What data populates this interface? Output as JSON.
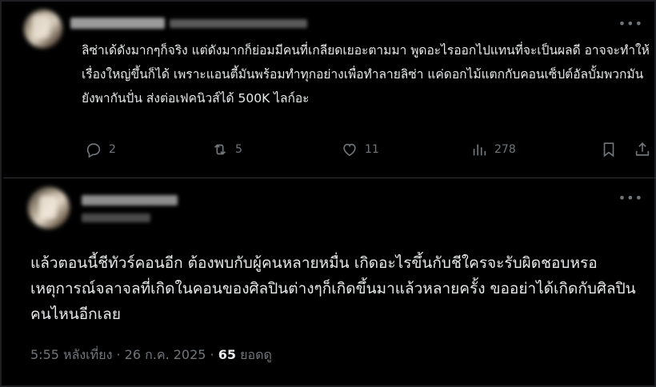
{
  "reply": {
    "text": "ลิซ่าเด้ดังมากๆก็จริง แต่ดังมากก็ย่อมมีคนที่เกลียดเยอะตามมา พูดอะไรออกไปแทนที่จะเป็นผลดี อาจจะทำให้เรื่องใหญ่ขึ้นก็ได้ เพราะแอนตี้มันพร้อมทำทุกอย่างเพื่อทำลายลิซ่า แค่ดอกไม้แตกกับคอนเซ็ปต์อัลบั้มพวกมันยังพากันปั่น ส่งต่อเฟคนิวส์ได้ 500K ไลก์อะ",
    "reply_count": "2",
    "repost_count": "5",
    "like_count": "11",
    "view_count": "278",
    "icons": [
      "reply-icon",
      "repost-icon",
      "like-icon",
      "views-icon",
      "bookmark-icon",
      "share-icon"
    ]
  },
  "main_post": {
    "text": "แล้วตอนนี้ชีทัวร์คอนอีก ต้องพบกับผู้คนหลายหมื่น เกิดอะไรขึ้นกับชีใครจะรับผิดชอบหรอ เหตุการณ์จลาจลที่เกิดในคอนของศิลปินต่างๆก็เกิดขึ้นมาแล้วหลายครั้ง ขออย่าได้เกิดกับศิลปินคนไหนอีกเลย",
    "time": "5:55 หลังเที่ยง",
    "sep1": " · ",
    "date": "26 ก.ค. 2025",
    "sep2": " · ",
    "views": "65",
    "views_label": " ยอดดู"
  },
  "more_icon": "more-icon",
  "colors": {
    "background": "#000000",
    "text": "#e7e9ea",
    "muted": "#71767b",
    "divider": "#2f3336"
  }
}
